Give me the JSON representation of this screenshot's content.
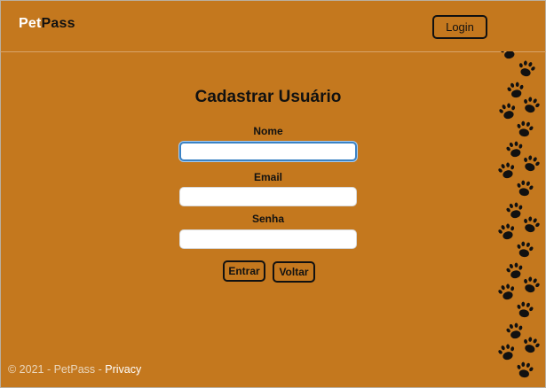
{
  "navbar": {
    "brand_part1": "Pet",
    "brand_part2": "Pass",
    "login_label": "Login"
  },
  "form": {
    "title": "Cadastrar Usuário",
    "fields": [
      {
        "label": "Nome",
        "value": ""
      },
      {
        "label": "Email",
        "value": ""
      },
      {
        "label": "Senha",
        "value": ""
      }
    ],
    "submit_label": "Entrar",
    "back_label": "Voltar"
  },
  "footer": {
    "copyright": "© 2021 - PetPass",
    "separator": " - ",
    "privacy_label": "Privacy"
  },
  "decoration": {
    "pattern_icon": "paw-print-icon"
  },
  "colors": {
    "background": "#c4781e",
    "brand_accent": "#ffffff",
    "focus_ring": "#3b82c4"
  }
}
